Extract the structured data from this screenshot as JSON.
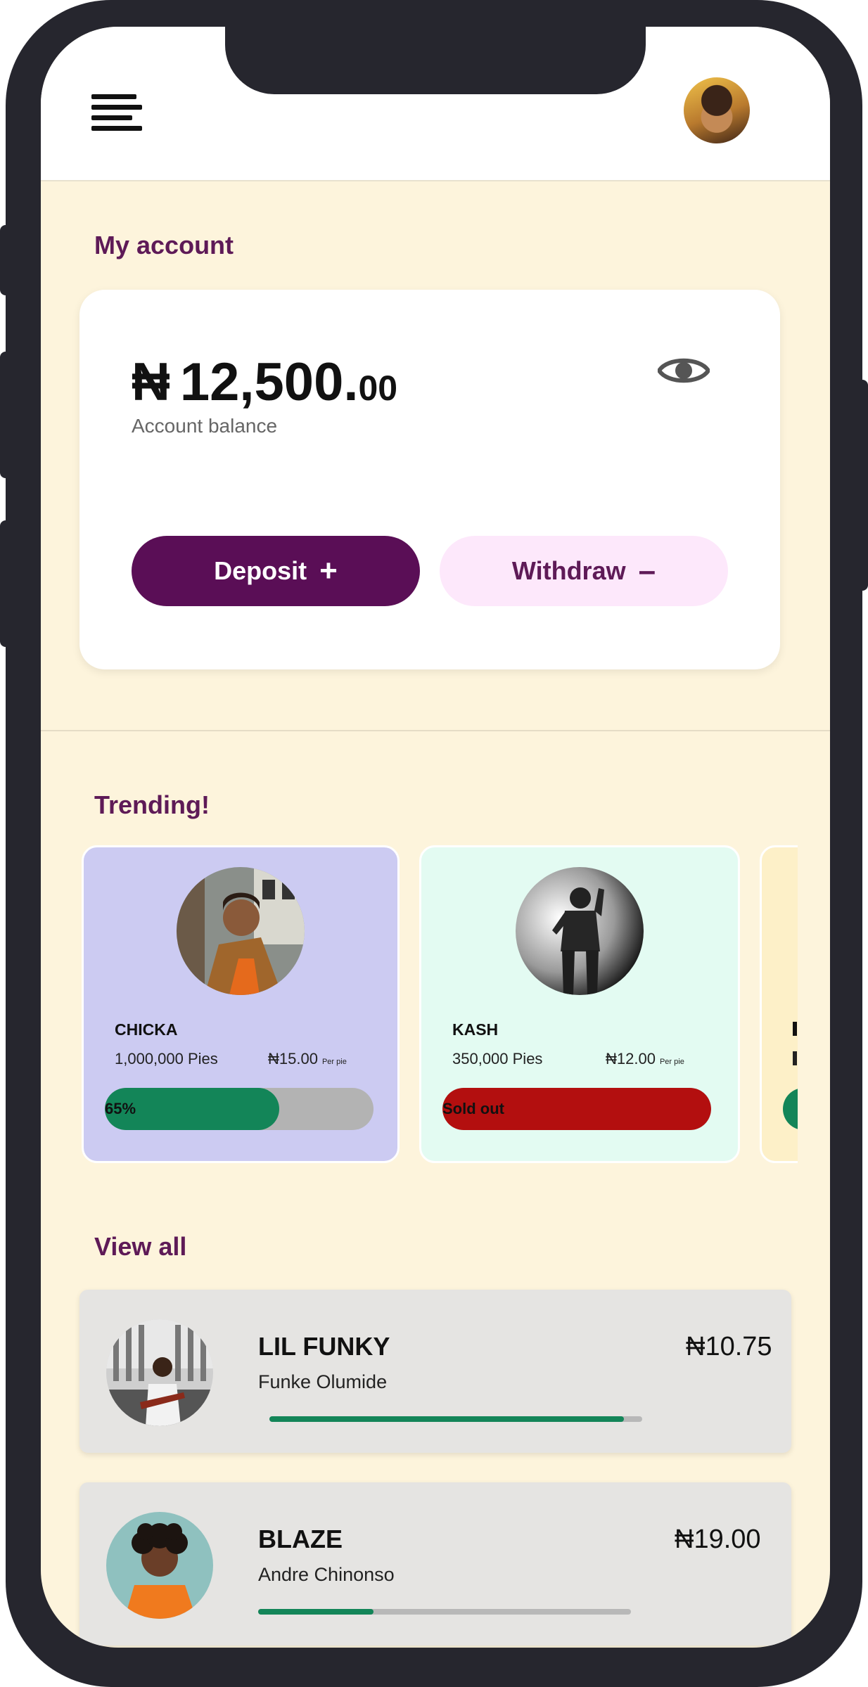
{
  "header": {
    "menu_icon": "hamburger-menu-icon",
    "avatar_icon": "user-avatar"
  },
  "account": {
    "section_title": "My account",
    "currency": "₦",
    "balance_main": "12,500.",
    "balance_cents": "00",
    "balance_label": "Account balance",
    "eye_icon": "eye-icon",
    "deposit_label": "Deposit",
    "deposit_symbol": "+",
    "withdraw_label": "Withdraw",
    "withdraw_symbol": "–"
  },
  "trending": {
    "section_title": "Trending!",
    "items": [
      {
        "name": "CHICKA",
        "pies": "1,000,000 Pies",
        "price": "₦15.00",
        "per_label": "Per pie",
        "progress_label": "65%",
        "progress": 0.65,
        "bg_color": "#cccbf2",
        "fill_color": "#138558"
      },
      {
        "name": "KASH",
        "pies": "350,000 Pies",
        "price": "₦12.00",
        "per_label": "Per pie",
        "progress_label": "Sold out",
        "progress": 1.0,
        "bg_color": "#e3fbf2",
        "fill_color": "#b30f0f"
      }
    ],
    "partial_card_color": "#fdf0c8"
  },
  "view_all": {
    "section_title": "View all",
    "items": [
      {
        "name": "LIL FUNKY",
        "artist": "Funke Olumide",
        "price": "₦10.75",
        "progress": 0.95
      },
      {
        "name": "BLAZE",
        "artist": "Andre Chinonso",
        "price": "₦19.00",
        "progress": 0.31
      }
    ]
  },
  "colors": {
    "brand_purple": "#5a0e56",
    "heading_purple": "#5e1a57",
    "background_cream": "#fdf4dc",
    "progress_green": "#138558",
    "sold_out_red": "#b30f0f"
  }
}
